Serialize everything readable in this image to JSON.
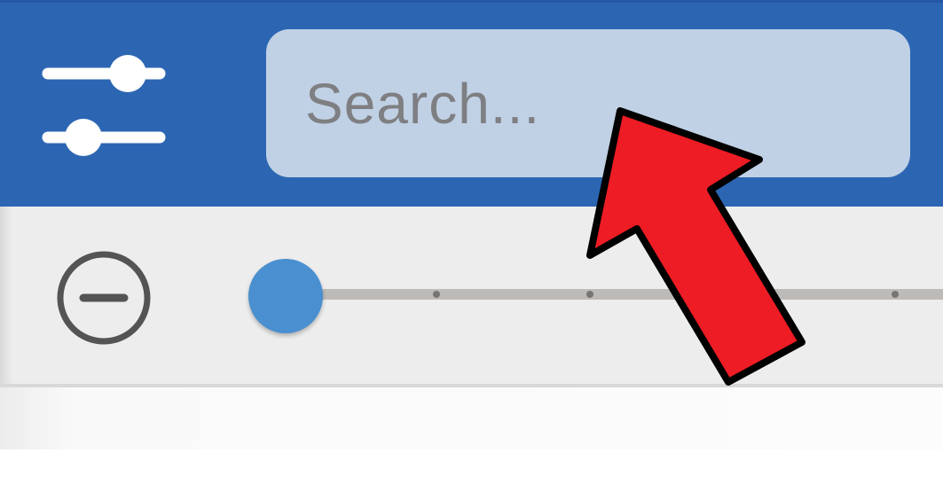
{
  "toolbar": {
    "filter_icon": "sliders-filter-icon",
    "search": {
      "placeholder": "Search...",
      "value": ""
    },
    "background_color": "#2c66b3",
    "search_background_color": "#c0d1e5"
  },
  "zoom": {
    "zoom_out_icon": "minus-circle-icon",
    "slider_level": 0,
    "thumb_color": "#4a8fd0"
  },
  "annotation": {
    "icon": "red-arrow-pointer",
    "color": "#ee1c24"
  }
}
